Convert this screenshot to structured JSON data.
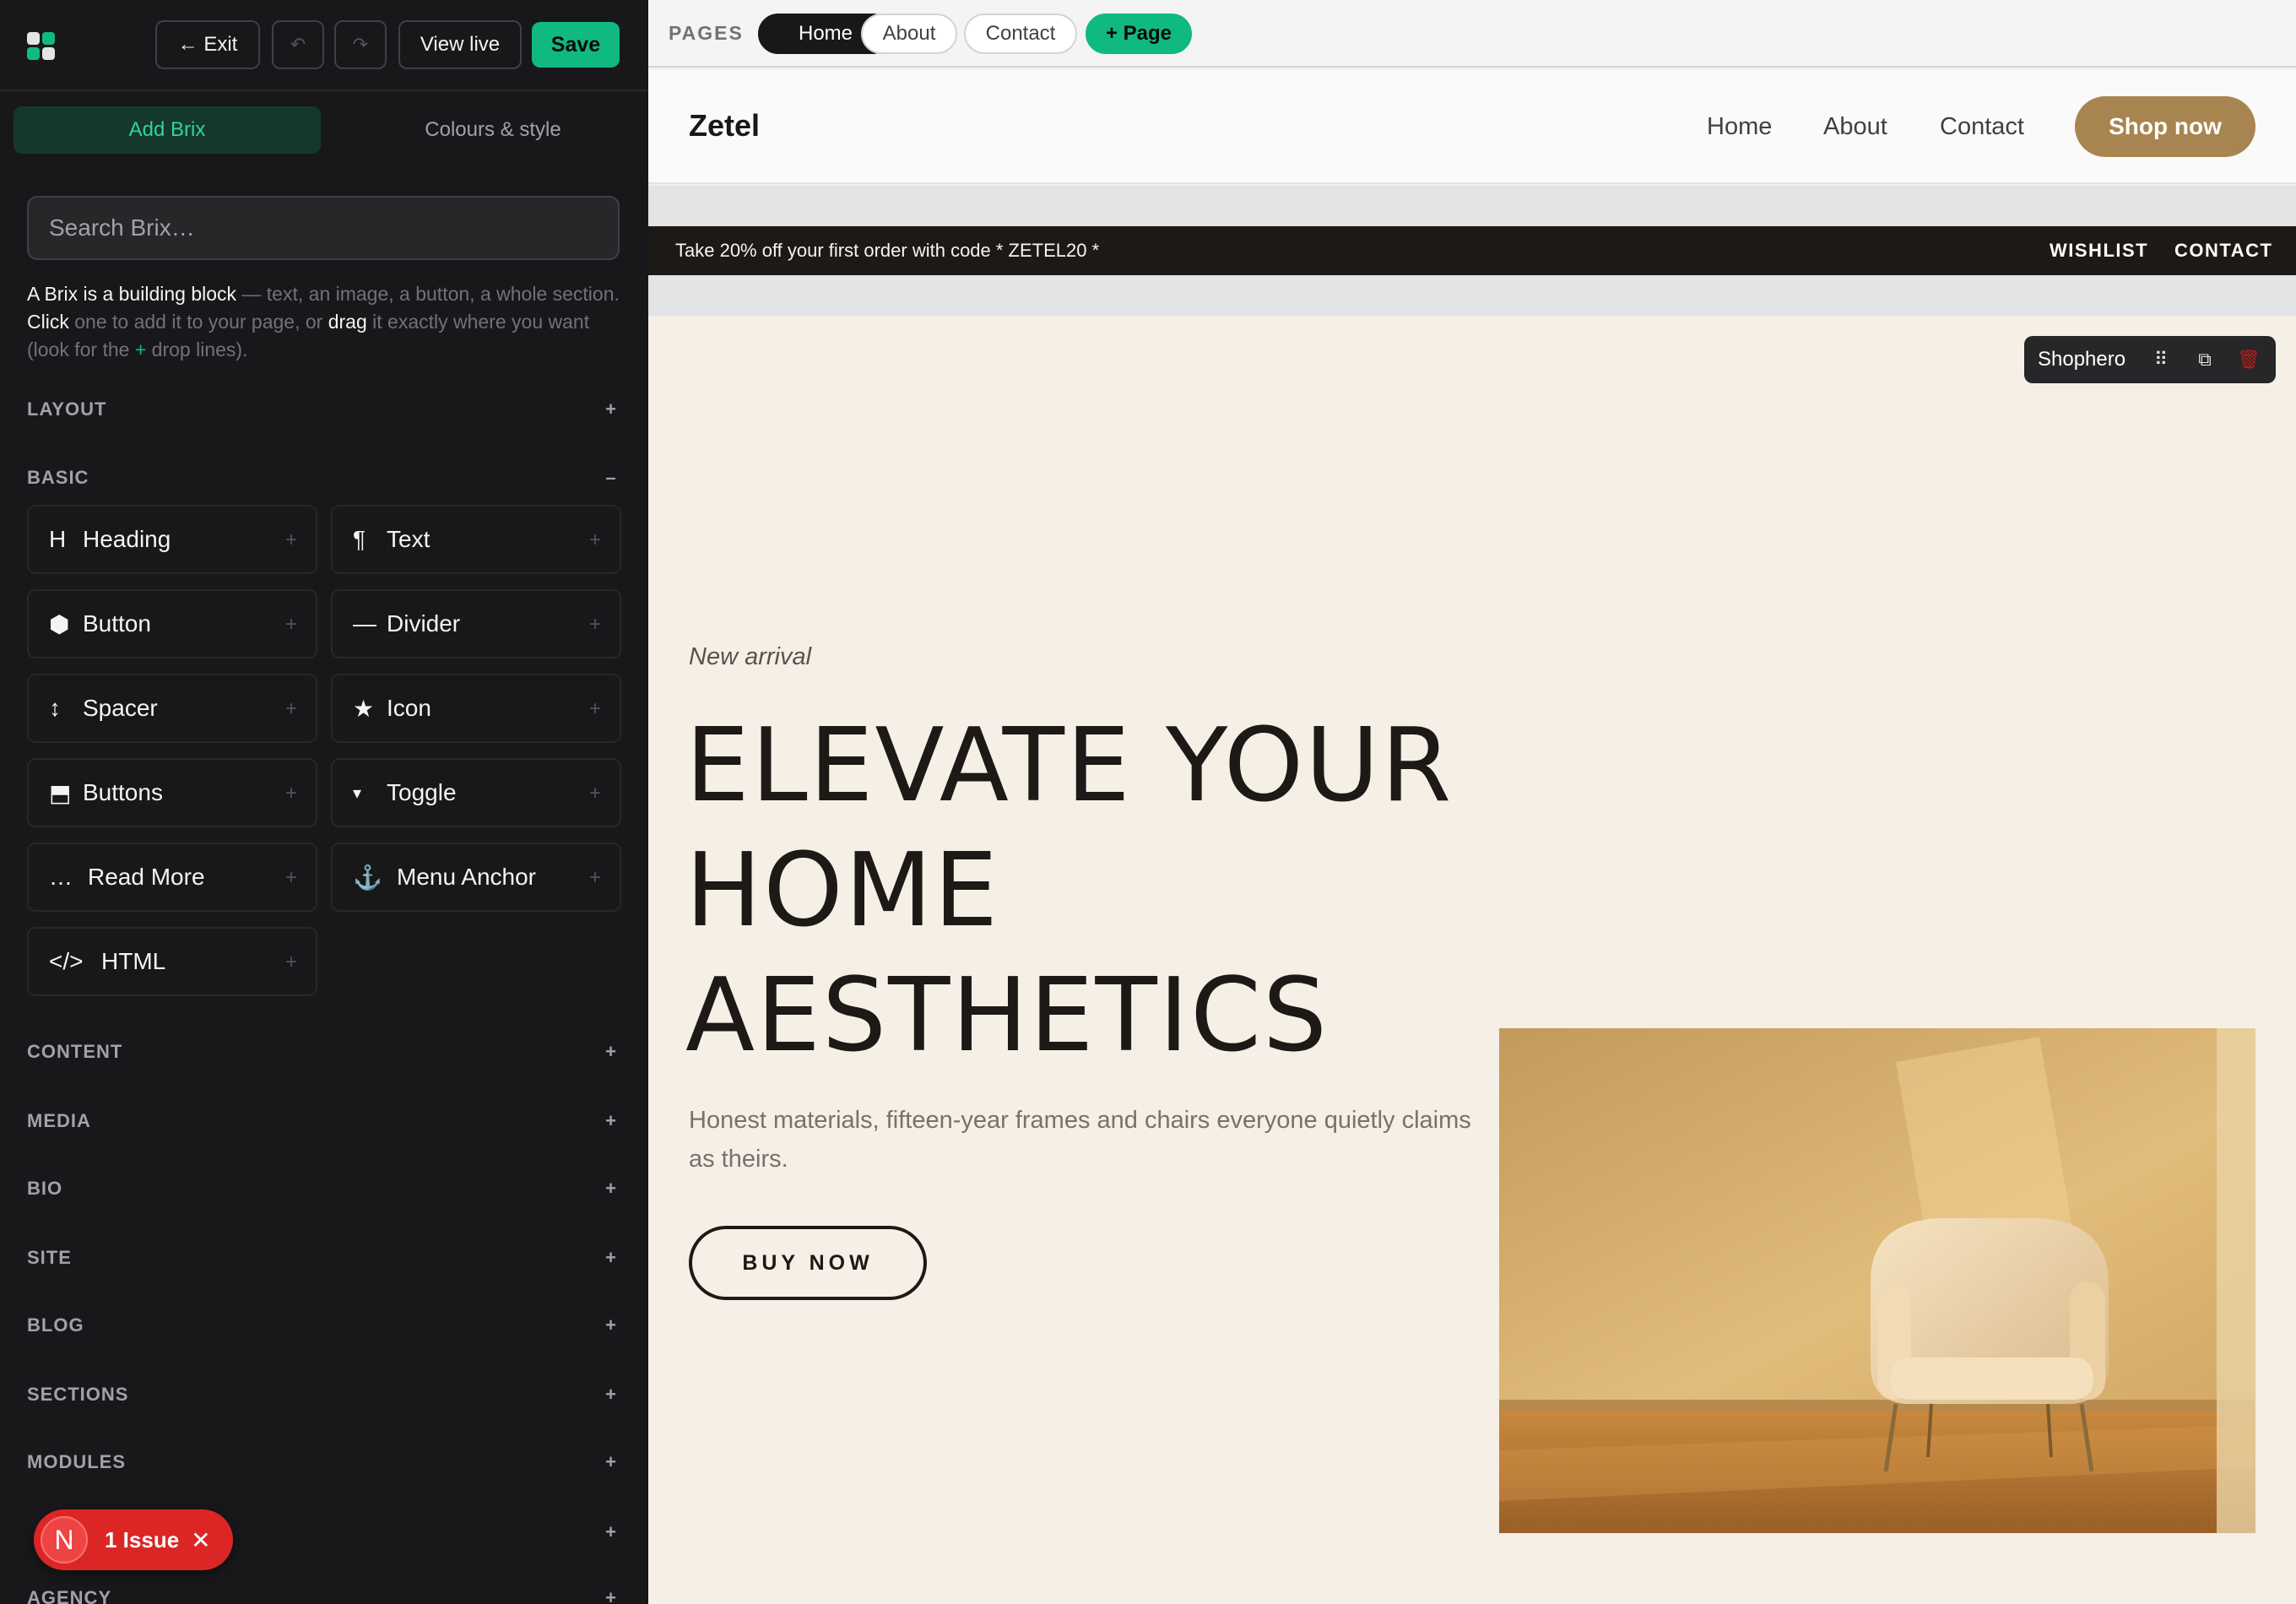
{
  "editor": {
    "exit_label": "← Exit",
    "undo_icon": "↶",
    "redo_icon": "↷",
    "view_live_label": "View live",
    "save_label": "Save",
    "tabs": {
      "add": "Add Brix",
      "style": "Colours & style"
    },
    "search": {
      "placeholder": "Search Brix…"
    },
    "intro": {
      "p1": "A Brix is a building block",
      "p2": " — text, an image, a button, a whole section. ",
      "p3": "Click",
      "p4": " one to add it to your page, or ",
      "p5": "drag",
      "p6": " it exactly where you want (look for the ",
      "p7": "+",
      "p8": " drop lines)."
    },
    "categories": {
      "layout": "LAYOUT",
      "basic": "BASIC",
      "content": "CONTENT",
      "media": "MEDIA",
      "bio": "BIO",
      "site": "SITE",
      "blog": "BLOG",
      "sections": "SECTIONS",
      "modules": "MODULES",
      "agency": "AGENCY"
    },
    "expand_sign": "+",
    "collapse_sign": "–",
    "basic_items": [
      {
        "label": "Heading",
        "icon": "H"
      },
      {
        "label": "Text",
        "icon": "¶"
      },
      {
        "label": "Button",
        "icon": "⬢"
      },
      {
        "label": "Divider",
        "icon": "—"
      },
      {
        "label": "Spacer",
        "icon": "↕"
      },
      {
        "label": "Icon",
        "icon": "★"
      },
      {
        "label": "Buttons",
        "icon": "⬒"
      },
      {
        "label": "Toggle",
        "icon": "▾"
      },
      {
        "label": "Read More",
        "icon": "…"
      },
      {
        "label": "Menu Anchor",
        "icon": "⚓"
      },
      {
        "label": "HTML",
        "icon": "</>"
      }
    ],
    "add_glyph": "+",
    "issue": {
      "badge": "N",
      "label": "1 Issue",
      "close": "✕"
    }
  },
  "pages": {
    "label": "PAGES",
    "items": [
      "Home",
      "About",
      "Contact"
    ],
    "add_label": "+ Page"
  },
  "site": {
    "brand": "Zetel",
    "nav": [
      "Home",
      "About",
      "Contact"
    ],
    "cta": "Shop now",
    "promo": {
      "text": "Take 20% off your first order with code * ZETEL20 *",
      "links": [
        "WISHLIST",
        "CONTACT"
      ]
    },
    "toolbar": {
      "name": "Shophero",
      "move": "⠿",
      "duplicate": "⧉",
      "delete": "🗑"
    },
    "hero": {
      "eyebrow": "New arrival",
      "headline": "ELEVATE YOUR HOME AESTHETICS",
      "lead": "Honest materials, fifteen-year frames and chairs everyone quietly claims as theirs.",
      "button": "BUY NOW"
    }
  },
  "colors": {
    "accent_green": "#10b981",
    "brand_gold": "#a88550",
    "sidebar_bg": "#18181b",
    "hero_bg": "#f5efe6",
    "promo_bg": "#1c1917"
  }
}
